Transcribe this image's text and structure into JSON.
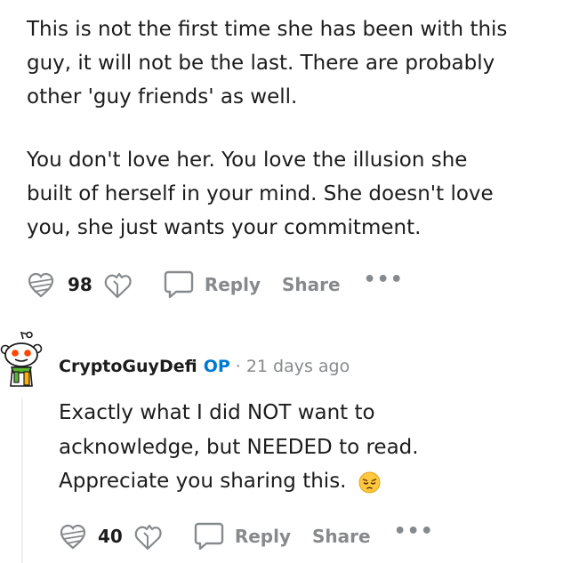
{
  "parent_comment": {
    "paragraphs": [
      {
        "lines": [
          "This is not the first time she has been with this",
          "guy, it will not be the last. There are probably",
          "other 'guy friends' as well."
        ]
      },
      {
        "lines": [
          "You don't love her. You love the illusion she",
          "built of herself in your mind. She doesn't love",
          "you, she just wants your commitment."
        ]
      }
    ],
    "actions": {
      "votes": "98",
      "reply_label": "Reply",
      "share_label": "Share",
      "more_label": "•••"
    }
  },
  "reply_comment": {
    "username": "CryptoGuyDefi",
    "op_badge": "OP",
    "separator": "·",
    "timestamp": "21 days ago",
    "lines": [
      "Exactly what I did NOT want to",
      "acknowledge, but NEEDED to read.",
      "Appreciate you sharing this."
    ],
    "emoji": "pensive-face",
    "actions": {
      "votes": "40",
      "reply_label": "Reply",
      "share_label": "Share",
      "more_label": "•••"
    }
  },
  "colors": {
    "accent_op": "#0079d3",
    "muted": "#878a8c",
    "text": "#1c1c1c",
    "thread_line": "#edeff1"
  },
  "icons": [
    "upvote-icon",
    "downvote-icon",
    "comment-icon",
    "more-icon",
    "snoo-avatar-icon"
  ]
}
